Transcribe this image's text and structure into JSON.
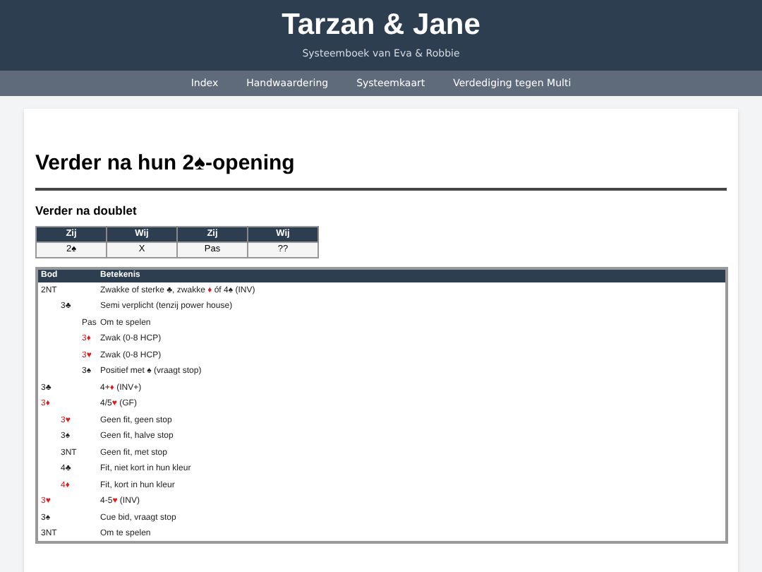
{
  "header": {
    "title": "Tarzan & Jane",
    "subtitle": "Systeemboek van Eva & Robbie"
  },
  "nav": [
    {
      "label": "Index"
    },
    {
      "label": "Handwaardering"
    },
    {
      "label": "Systeemkaart"
    },
    {
      "label": "Verdediging tegen Multi"
    }
  ],
  "page_title": "Verder na hun 2♠-opening",
  "section_title": "Verder na doublet",
  "auction": {
    "columns": [
      "Zij",
      "Wij",
      "Zij",
      "Wij"
    ],
    "cells": [
      "2♠",
      "X",
      "Pas",
      "??"
    ]
  },
  "bids_table": {
    "columns": [
      "Bod",
      "Betekenis"
    ],
    "rows": [
      {
        "bid": "2NT",
        "meaning": "Zwakke of sterke ♣, zwakke ♦ óf 4♠ (INV)",
        "children": [
          {
            "bid": "3♣",
            "meaning": "Semi verplicht (tenzij power house)",
            "children": [
              {
                "bid": "Pas",
                "meaning": "Om te spelen"
              },
              {
                "bid": "3♦",
                "meaning": "Zwak (0-8 HCP)"
              },
              {
                "bid": "3♥",
                "meaning": "Zwak (0-8 HCP)"
              },
              {
                "bid": "3♠",
                "meaning": "Positief met ♠ (vraagt stop)"
              }
            ]
          }
        ]
      },
      {
        "bid": "3♣",
        "meaning": "4+♦ (INV+)"
      },
      {
        "bid": "3♦",
        "meaning": "4/5♥ (GF)",
        "children": [
          {
            "bid": "3♥",
            "meaning": "Geen fit, geen stop"
          },
          {
            "bid": "3♠",
            "meaning": "Geen fit, halve stop"
          },
          {
            "bid": "3NT",
            "meaning": "Geen fit, met stop"
          },
          {
            "bid": "4♣",
            "meaning": "Fit, niet kort in hun kleur"
          },
          {
            "bid": "4♦",
            "meaning": "Fit, kort in hun kleur"
          }
        ]
      },
      {
        "bid": "3♥",
        "meaning": "4-5♥ (INV)"
      },
      {
        "bid": "3♠",
        "meaning": "Cue bid, vraagt stop"
      },
      {
        "bid": "3NT",
        "meaning": "Om te spelen"
      }
    ]
  }
}
